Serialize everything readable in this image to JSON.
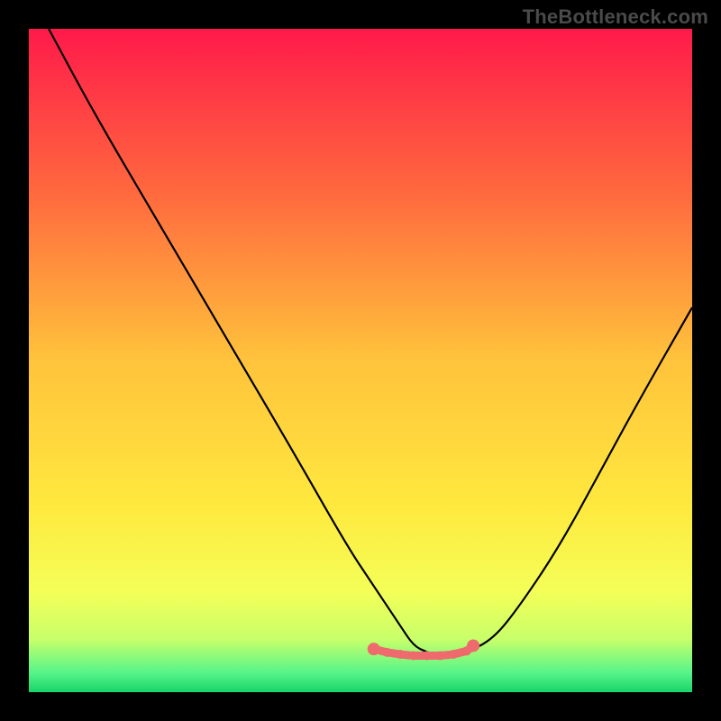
{
  "watermark": "TheBottleneck.com",
  "chart_data": {
    "type": "line",
    "title": "",
    "xlabel": "",
    "ylabel": "",
    "xlim": [
      0,
      100
    ],
    "ylim": [
      0,
      100
    ],
    "grid": false,
    "legend": false,
    "series": [
      {
        "name": "bottleneck-curve",
        "x": [
          3,
          10,
          20,
          30,
          40,
          48,
          52,
          56,
          58,
          60,
          62,
          64,
          66,
          70,
          74,
          80,
          86,
          92,
          100
        ],
        "y": [
          100,
          87,
          70,
          53,
          36,
          22,
          16,
          10,
          7,
          6,
          5.5,
          5.5,
          6,
          8,
          13,
          22,
          33,
          44,
          58
        ]
      }
    ],
    "background_gradient": {
      "stops": [
        {
          "pos": 0.0,
          "color": "#ff1a4a"
        },
        {
          "pos": 0.25,
          "color": "#ff6a3e"
        },
        {
          "pos": 0.5,
          "color": "#ffc33c"
        },
        {
          "pos": 0.72,
          "color": "#ffe93e"
        },
        {
          "pos": 0.85,
          "color": "#f3ff58"
        },
        {
          "pos": 0.92,
          "color": "#c8ff6a"
        },
        {
          "pos": 0.97,
          "color": "#58f58a"
        },
        {
          "pos": 1.0,
          "color": "#18d56a"
        }
      ]
    },
    "markers": {
      "color": "#ef6a6d",
      "x": [
        52,
        54,
        56,
        58,
        60,
        62,
        64,
        66,
        67
      ],
      "y": [
        6.5,
        6,
        5.7,
        5.5,
        5.5,
        5.5,
        5.7,
        6.2,
        7
      ]
    }
  }
}
